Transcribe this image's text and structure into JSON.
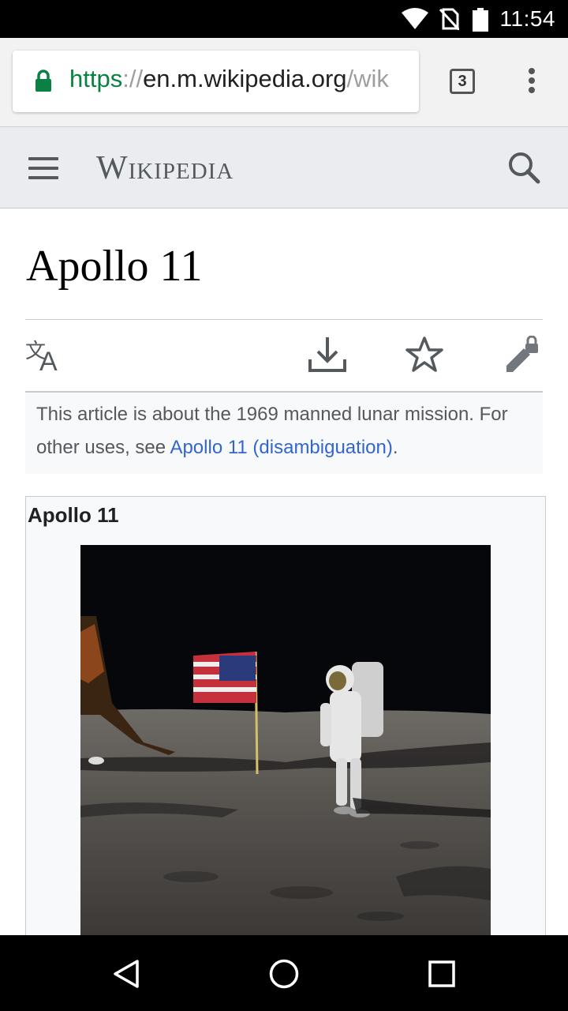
{
  "status_bar": {
    "time": "11:54"
  },
  "browser": {
    "url_scheme": "https",
    "url_separator": "://",
    "url_host": "en.m.wikipedia.org",
    "url_path": "/wik",
    "tab_count": "3"
  },
  "wiki": {
    "wordmark": "Wikipedia"
  },
  "article": {
    "title": "Apollo 11",
    "hatnote_text": "This article is about the 1969 manned lunar mission. For other uses, see ",
    "hatnote_link": "Apollo 11 (disambiguation)",
    "hatnote_end": ".",
    "infobox_title": "Apollo 11"
  },
  "icons": {
    "lock": "lock-icon",
    "language": "language-icon",
    "download": "download-icon",
    "watch": "star-icon",
    "edit": "edit-locked-icon"
  },
  "colors": {
    "link": "#3366cc",
    "secure": "#0b8043",
    "header_bg": "#eaecf0"
  }
}
